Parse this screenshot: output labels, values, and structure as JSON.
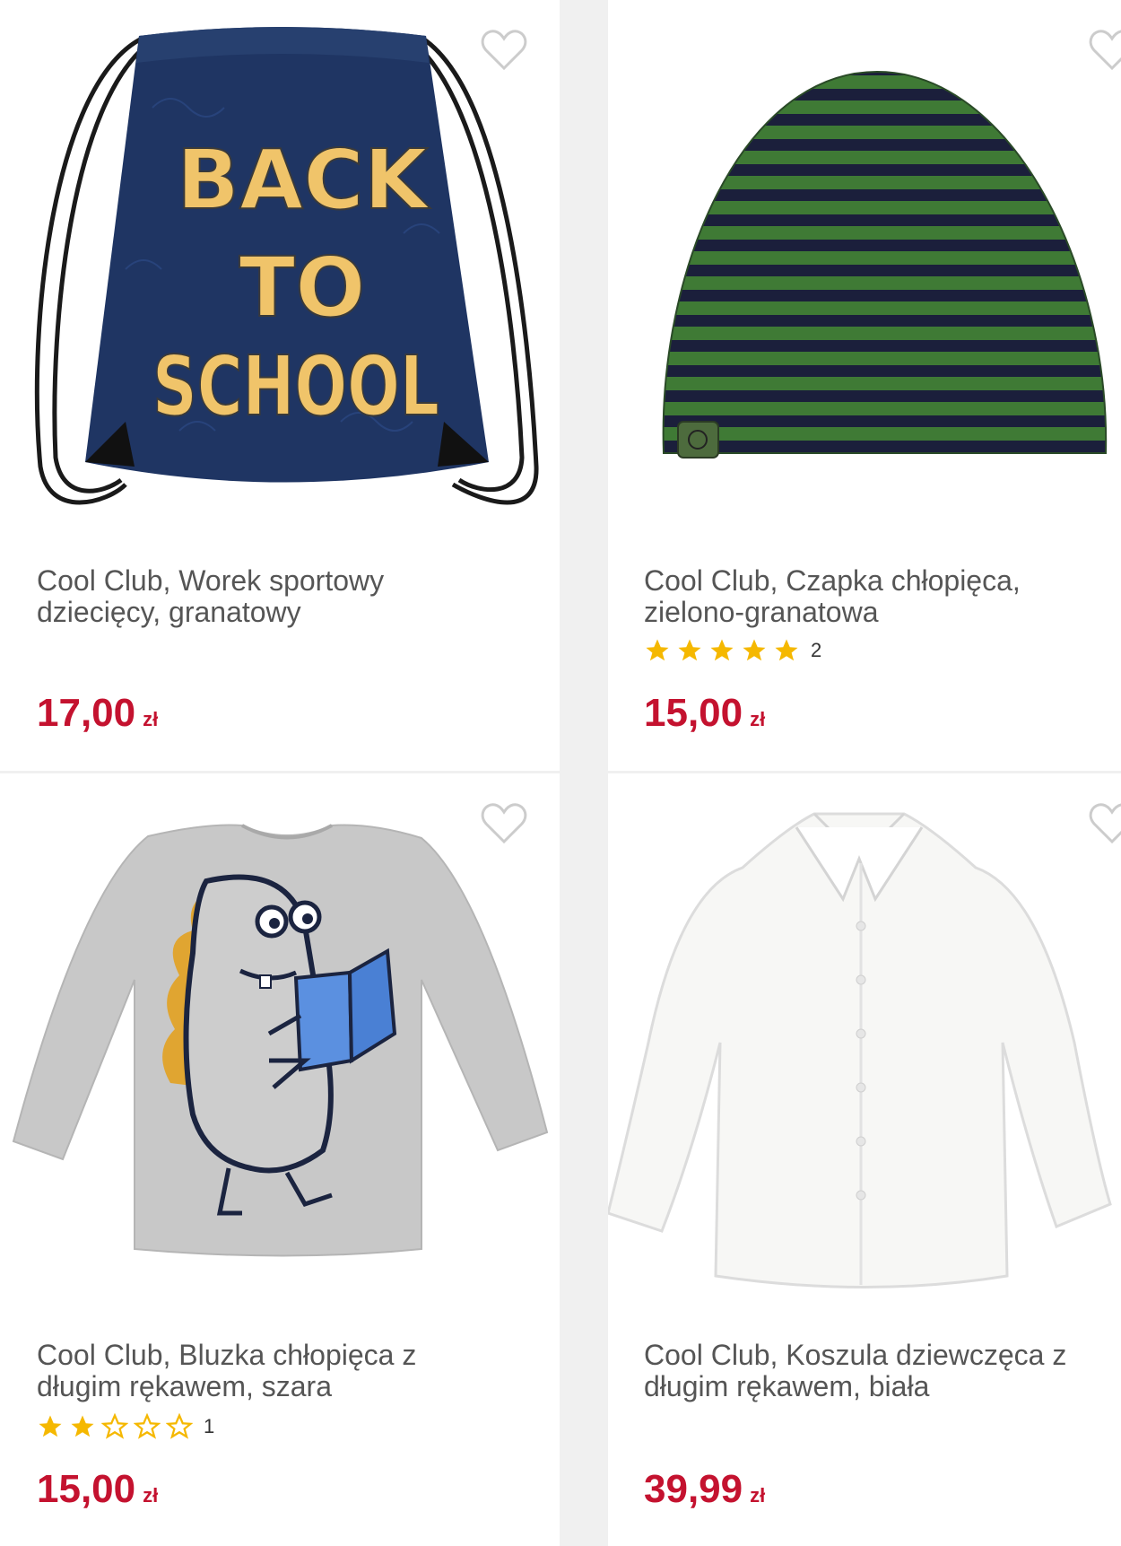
{
  "products": [
    {
      "title": "Cool Club, Worek sportowy dziecięcy, granatowy",
      "price": "17,00",
      "currency": "zł",
      "rating_filled": 0,
      "rating_count": "",
      "image_text": [
        "BACK",
        "TO",
        "SCHOOL"
      ]
    },
    {
      "title": "Cool Club, Czapka chłopięca, zielono-granatowa",
      "price": "15,00",
      "currency": "zł",
      "rating_filled": 5,
      "rating_count": "2"
    },
    {
      "title": "Cool Club, Bluzka chłopięca z długim rękawem, szara",
      "price": "15,00",
      "currency": "zł",
      "rating_filled": 2,
      "rating_count": "1"
    },
    {
      "title": "Cool Club, Koszula dziewczęca z długim rękawem, biała",
      "price": "39,99",
      "currency": "zł",
      "rating_filled": 0,
      "rating_count": ""
    }
  ],
  "colors": {
    "price": "#c4122f",
    "star": "#f5b800",
    "background": "#f0f0f0"
  },
  "icons": [
    "heart-outline-icon",
    "star-filled-icon",
    "star-outline-icon"
  ]
}
